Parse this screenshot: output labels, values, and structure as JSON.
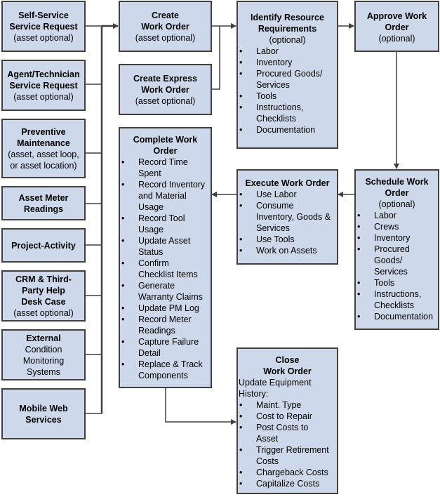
{
  "sources": [
    {
      "title": "Self-Service Service Request",
      "title_lines": [
        "Self-Service",
        "Service Request"
      ],
      "sub_lines": [
        "(asset optional)"
      ]
    },
    {
      "title": "Agent/Technician Service Request",
      "title_lines": [
        "Agent/Technician",
        "Service Request"
      ],
      "sub_lines": [
        "(asset optional)"
      ]
    },
    {
      "title": "Preventive Maintenance",
      "title_lines": [
        "Preventive",
        "Maintenance"
      ],
      "sub_lines": [
        "(asset, asset loop,",
        "or asset location)"
      ]
    },
    {
      "title": "Asset Meter Readings",
      "title_lines": [
        "Asset Meter",
        "Readings"
      ],
      "sub_lines": []
    },
    {
      "title": "Project-Activity",
      "title_lines": [
        "Project-Activity"
      ],
      "sub_lines": []
    },
    {
      "title": "CRM & Third-Party Help Desk Case",
      "title_lines": [
        "CRM & Third-",
        "Party Help",
        "Desk Case"
      ],
      "sub_lines": [
        "(asset optional)"
      ]
    },
    {
      "title": "External Condition Monitoring Systems",
      "title_lines": [
        "External"
      ],
      "sub_lines": [
        "Condition",
        "Monitoring",
        "Systems"
      ]
    },
    {
      "title": "Mobile Web Services",
      "title_lines": [
        "Mobile Web",
        "Services"
      ],
      "sub_lines": []
    }
  ],
  "create": {
    "title_lines": [
      "Create",
      "Work Order"
    ],
    "sub": "(asset optional)"
  },
  "express": {
    "title_lines": [
      "Create Express",
      "Work Order"
    ],
    "sub": "(asset optional)"
  },
  "identify": {
    "title_lines": [
      "Identify Resource",
      "Requirements"
    ],
    "sub": "(optional)",
    "items": [
      "Labor",
      "Inventory",
      "Procured Goods/ Services",
      "Tools",
      "Instructions, Checklists",
      "Documentation"
    ]
  },
  "approve": {
    "title_lines": [
      "Approve Work",
      "Order"
    ],
    "sub": "(optional)"
  },
  "schedule": {
    "title_lines": [
      "Schedule Work",
      "Order"
    ],
    "sub": "(optional)",
    "items": [
      "Labor",
      "Crews",
      "Inventory",
      "Procured Goods/ Services",
      "Tools",
      "Instructions, Checklists",
      "Documentation"
    ]
  },
  "execute": {
    "title": "Execute Work Order",
    "items": [
      "Use Labor",
      "Consume Inventory, Goods & Services",
      "Use Tools",
      "Work on Assets"
    ]
  },
  "complete": {
    "title_lines": [
      "Complete Work",
      "Order"
    ],
    "items": [
      "Record Time Spent",
      "Record Inventory and Material Usage",
      "Record Tool Usage",
      "Update Asset Status",
      "Confirm Checklist Items",
      "Generate Warranty Claims",
      "Update PM Log",
      "Record Meter Readings",
      "Capture Failure Detail",
      "Replace & Track Components"
    ]
  },
  "close": {
    "title_lines": [
      "Close",
      "Work Order"
    ],
    "intro": "Update Equipment History:",
    "items": [
      "Maint. Type",
      "Cost to Repair",
      "Post Costs to Asset",
      "Trigger Retirement Costs",
      "Chargeback Costs",
      "Capitalize Costs"
    ]
  },
  "colors": {
    "box_fill": "#cdd9ea",
    "border": "#404040",
    "line": "#404040"
  }
}
